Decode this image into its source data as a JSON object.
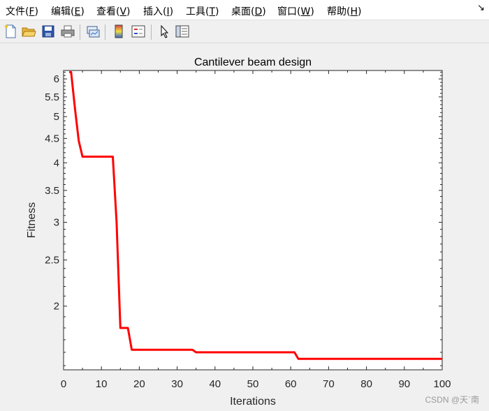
{
  "menu": [
    {
      "label": "文件(",
      "key": "F",
      "end": ")"
    },
    {
      "label": "编辑(",
      "key": "E",
      "end": ")"
    },
    {
      "label": "查看(",
      "key": "V",
      "end": ")"
    },
    {
      "label": "插入(",
      "key": "I",
      "end": ")"
    },
    {
      "label": "工具(",
      "key": "T",
      "end": ")"
    },
    {
      "label": "桌面(",
      "key": "D",
      "end": ")"
    },
    {
      "label": "窗口(",
      "key": "W",
      "end": ")"
    },
    {
      "label": "帮助(",
      "key": "H",
      "end": ")"
    }
  ],
  "menu_corner": "↘",
  "toolbar_icons": [
    "new-figure-icon",
    "open-file-icon",
    "save-icon",
    "print-icon",
    "link-plot-icon",
    "colorbar-icon",
    "legend-icon",
    "pointer-icon",
    "property-editor-icon"
  ],
  "watermark": "CSDN @天`南",
  "chart_data": {
    "type": "line",
    "title": "Cantilever beam design",
    "xlabel": "Iterations",
    "ylabel": "Fitness",
    "yscale": "log",
    "xlim": [
      0,
      100
    ],
    "ylim": [
      1.47,
      6.25
    ],
    "xticks": [
      0,
      10,
      20,
      30,
      40,
      50,
      60,
      70,
      80,
      90,
      100
    ],
    "yticks": [
      2,
      2.5,
      3,
      3.5,
      4,
      4.5,
      5,
      5.5,
      6
    ],
    "grid": false,
    "series": [
      {
        "color": "#ff0000",
        "x": [
          1.5,
          2,
          3,
          4,
          5,
          6,
          12,
          13,
          14,
          15,
          16,
          17,
          18,
          34,
          35,
          61,
          62,
          100
        ],
        "y": [
          6.2,
          6.2,
          5.2,
          4.45,
          4.12,
          4.12,
          4.12,
          4.12,
          3.0,
          1.8,
          1.8,
          1.8,
          1.62,
          1.62,
          1.6,
          1.6,
          1.55,
          1.55
        ]
      }
    ]
  }
}
